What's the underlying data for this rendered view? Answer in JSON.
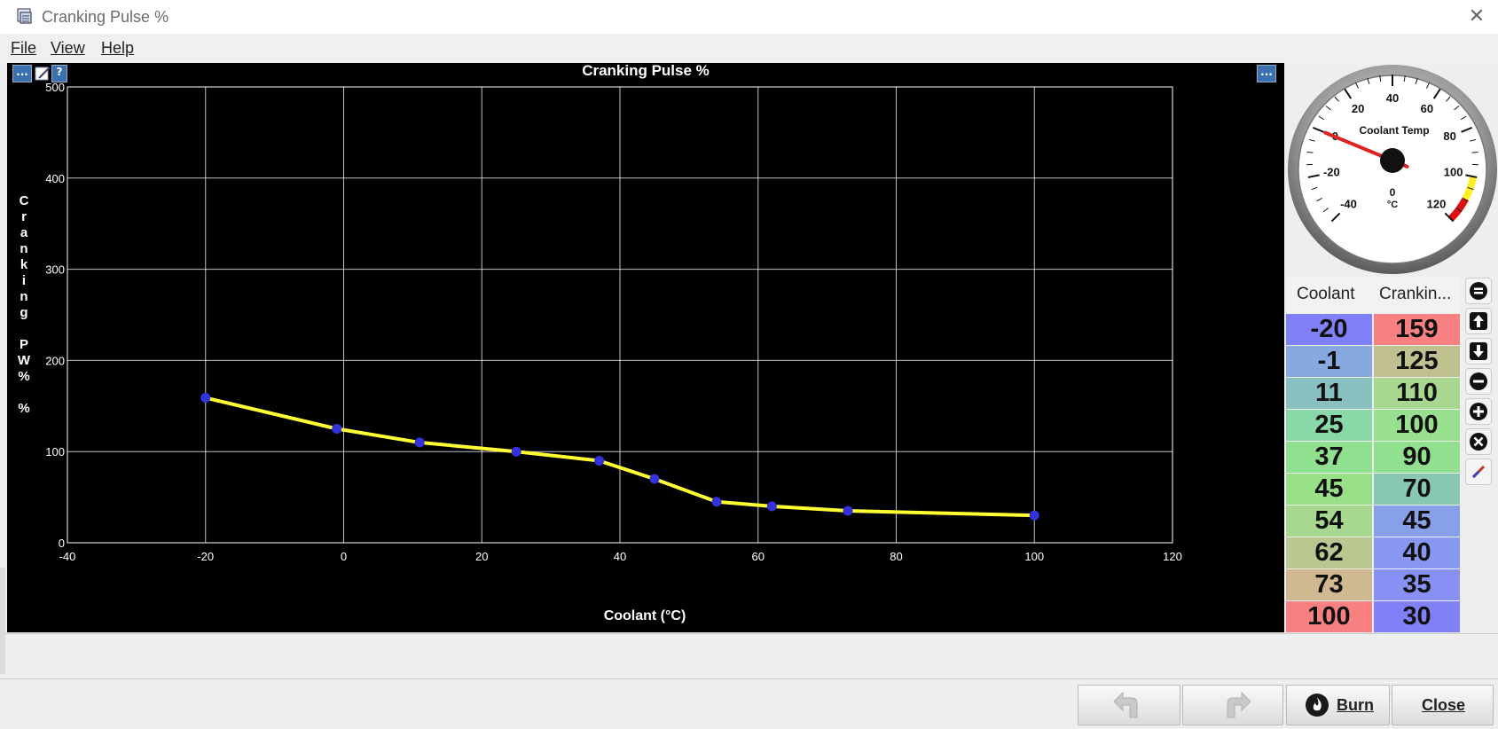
{
  "window": {
    "title": "Cranking Pulse %"
  },
  "menu": {
    "file": "File",
    "view": "View",
    "help": "Help"
  },
  "panel_buttons": {
    "options": "...",
    "help": "?",
    "options_right": "..."
  },
  "chart_data": {
    "type": "line",
    "title": "Cranking Pulse %",
    "xlabel": "Coolant (°C)",
    "ylabel": "Cranking PW%",
    "ylabel_letters": [
      "C",
      "r",
      "a",
      "n",
      "k",
      "i",
      "n",
      "g",
      "",
      "P",
      "W",
      "%",
      "",
      "%"
    ],
    "xlim": [
      -40,
      120
    ],
    "ylim": [
      0,
      500
    ],
    "x_ticks": [
      -40,
      -20,
      0,
      20,
      40,
      60,
      80,
      100,
      120
    ],
    "y_ticks": [
      0,
      100,
      200,
      300,
      400,
      500
    ],
    "grid": true,
    "series": [
      {
        "x": [
          -20,
          -1,
          11,
          25,
          37,
          45,
          54,
          62,
          73,
          100
        ],
        "y": [
          159,
          125,
          110,
          100,
          90,
          70,
          45,
          40,
          35,
          30
        ]
      }
    ],
    "colors": {
      "line": "#ffff33",
      "point": "#3333dd",
      "background": "#000000",
      "grid": "#ffffff"
    }
  },
  "gauge": {
    "title": "Coolant Temp",
    "unit": "°C",
    "value": 0,
    "value_text": "0",
    "min": -40,
    "max": 120,
    "tick_labels": [
      "-40",
      "-20",
      "0",
      "20",
      "40",
      "60",
      "80",
      "100",
      "120"
    ],
    "warning_from": 100,
    "danger_from": 110
  },
  "table": {
    "headers": [
      "Coolant",
      "Crankin..."
    ],
    "rows": [
      {
        "coolant": "-20",
        "cranking": "159",
        "c_color": "#8080f8",
        "p_color": "#f88080"
      },
      {
        "coolant": "-1",
        "cranking": "125",
        "c_color": "#88a8e0",
        "p_color": "#c0c090"
      },
      {
        "coolant": "11",
        "cranking": "110",
        "c_color": "#88c0c0",
        "p_color": "#a8d890"
      },
      {
        "coolant": "25",
        "cranking": "100",
        "c_color": "#88d8a8",
        "p_color": "#98e090"
      },
      {
        "coolant": "37",
        "cranking": "90",
        "c_color": "#90e090",
        "p_color": "#90e090"
      },
      {
        "coolant": "45",
        "cranking": "70",
        "c_color": "#98e088",
        "p_color": "#88c8b0"
      },
      {
        "coolant": "54",
        "cranking": "45",
        "c_color": "#a8d890",
        "p_color": "#88a0e8"
      },
      {
        "coolant": "62",
        "cranking": "40",
        "c_color": "#b8c890",
        "p_color": "#8898f0"
      },
      {
        "coolant": "73",
        "cranking": "35",
        "c_color": "#d0b890",
        "p_color": "#8890f4"
      },
      {
        "coolant": "100",
        "cranking": "30",
        "c_color": "#f88080",
        "p_color": "#8080f8"
      }
    ]
  },
  "bottom": {
    "burn": "Burn",
    "close": "Close"
  }
}
